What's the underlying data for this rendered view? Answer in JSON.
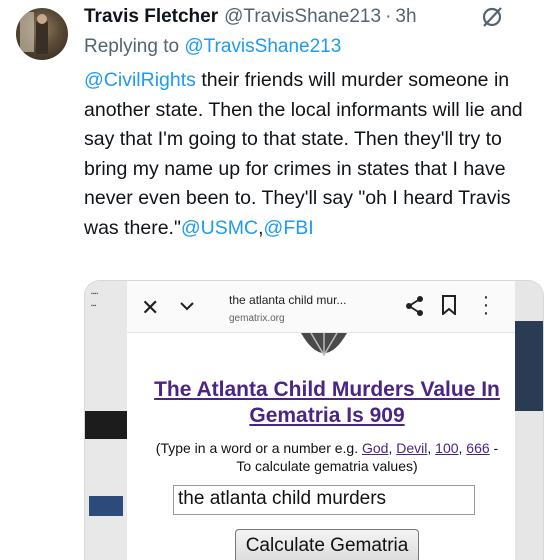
{
  "tweet": {
    "author_name": "Travis Fletcher",
    "author_handle": "@TravisShane213",
    "separator": "·",
    "time": "3h",
    "replying_prefix": "Replying to",
    "replying_to": "@TravisShane213",
    "mention_start": "@CivilRights",
    "text_main": " their friends will murder someone in another state. Then the local informants will lie and say that I'm going to that state. Then they'll try to bring my name up for crimes in states that I have never even been to. They'll say \"oh I heard Travis was there.\"",
    "mention_end_1": "@USMC",
    "comma": ",",
    "mention_end_2": "@FBI"
  },
  "screenshot": {
    "browser_title": "the atlanta child mur...",
    "browser_url": "gematrix.org",
    "result_title": "The Atlanta Child Murders Value In Gematria Is 909",
    "hint_prefix": "(Type in a word or a number e.g.",
    "hint_links": [
      "God",
      "Devil",
      "100",
      "666"
    ],
    "hint_suffix": "-",
    "hint_line2": "To calculate gematria values)",
    "input_value": "the atlanta child murders",
    "button_label": "Calculate Gematria"
  },
  "icons": [
    "grok-icon",
    "close-icon",
    "chevron-down-icon",
    "share-icon",
    "bookmark-icon",
    "more-vertical-icon"
  ],
  "colors": {
    "link": "#1d9bf0",
    "muted": "#536471",
    "gematria_title": "#4b2584"
  }
}
